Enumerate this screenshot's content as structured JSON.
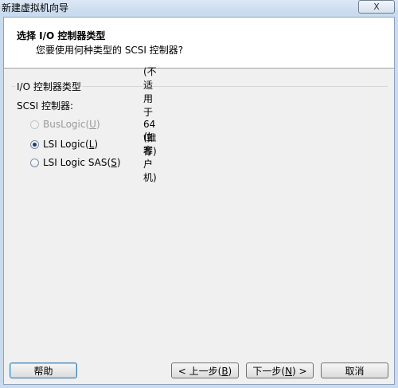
{
  "window": {
    "title": "新建虚拟机向导",
    "close_label": "X"
  },
  "header": {
    "title": "选择 I/O 控制器类型",
    "subtitle": "您要使用何种类型的 SCSI 控制器?"
  },
  "group": {
    "label": "I/O 控制器类型",
    "scsi_label": "SCSI 控制器:",
    "options": [
      {
        "label_prefix": "BusLogic(",
        "mnemonic": "U",
        "label_suffix": ")",
        "note": "(不适用于 64 位客户机)",
        "checked": false,
        "disabled": true
      },
      {
        "label_prefix": "LSI Logic(",
        "mnemonic": "L",
        "label_suffix": ")",
        "note": "(推荐)",
        "checked": true,
        "disabled": false
      },
      {
        "label_prefix": "LSI Logic SAS(",
        "mnemonic": "S",
        "label_suffix": ")",
        "note": "",
        "checked": false,
        "disabled": false
      }
    ]
  },
  "buttons": {
    "help": "帮助",
    "back_prefix": "< 上一步(",
    "back_key": "B",
    "back_suffix": ")",
    "next_prefix": "下一步(",
    "next_key": "N",
    "next_suffix": ") >",
    "cancel": "取消"
  }
}
